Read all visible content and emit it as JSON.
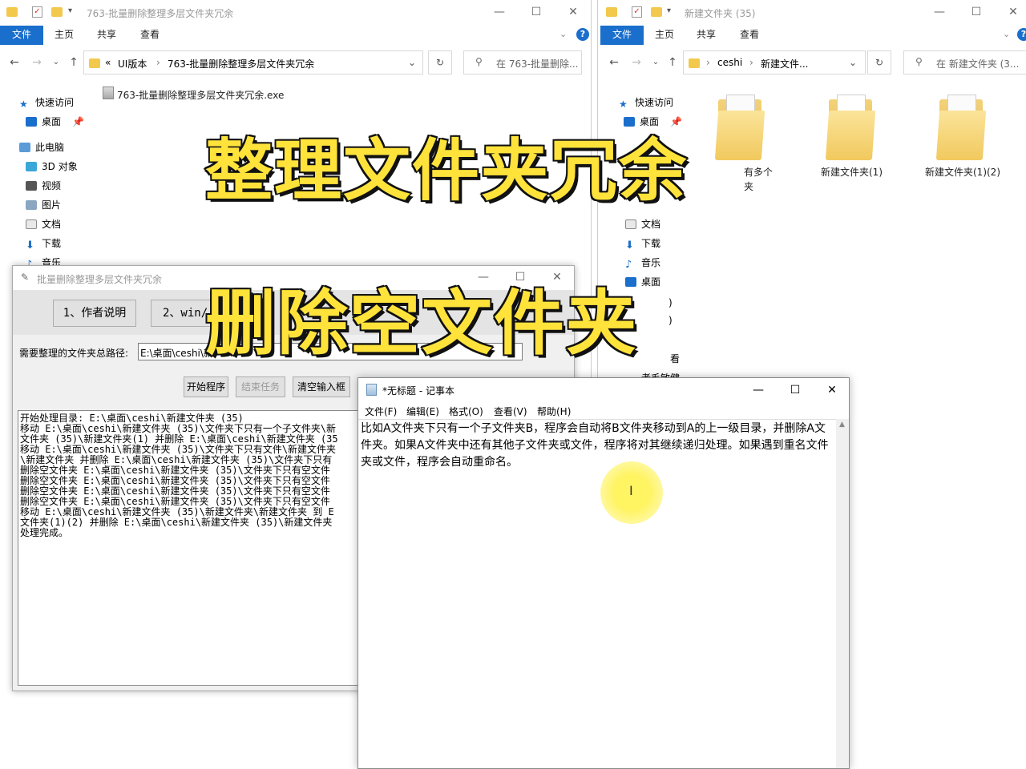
{
  "explorer_left": {
    "title": "763-批量删除整理多层文件夹冗余",
    "ribbon_tabs": [
      "文件",
      "主页",
      "共享",
      "查看"
    ],
    "address": [
      "«",
      "UI版本",
      "›",
      "763-批量删除整理多层文件夹冗余"
    ],
    "search_placeholder": "在 763-批量删除...",
    "file_name": "763-批量删除整理多层文件夹冗余.exe",
    "nav": [
      "快速访问",
      "桌面",
      "此电脑",
      "3D 对象",
      "视频",
      "图片",
      "文档",
      "下载",
      "音乐"
    ]
  },
  "explorer_right": {
    "title": "新建文件夹 (35)",
    "ribbon_tabs": [
      "文件",
      "主页",
      "共享",
      "查看"
    ],
    "address": [
      "›",
      "ceshi",
      "›",
      "新建文件..."
    ],
    "search_placeholder": "在 新建文件夹 (3...",
    "nav": [
      "快速访问",
      "桌面",
      "文档",
      "下载",
      "音乐",
      "桌面"
    ],
    "folders": [
      "有多个",
      "新建文件夹(1)",
      "新建文件夹(1)(2)"
    ],
    "folder_subtext": "夹",
    "partial_texts": [
      ")",
      ")",
      "看",
      "者毛敏健"
    ]
  },
  "tool_window": {
    "title": "批量删除整理多层文件夹冗余",
    "tab_buttons": [
      "1、作者说明",
      "2、win/"
    ],
    "path_label": "需要整理的文件夹总路径:",
    "path_value": "E:\\桌面\\ceshi\\新",
    "buttons": [
      "开始程序",
      "结束任务",
      "清空输入框"
    ],
    "log_lines": [
      "开始处理目录: E:\\桌面\\ceshi\\新建文件夹 (35)",
      "移动 E:\\桌面\\ceshi\\新建文件夹 (35)\\文件夹下只有一个子文件夹\\新",
      "文件夹 (35)\\新建文件夹(1) 并删除 E:\\桌面\\ceshi\\新建文件夹 (35",
      "移动 E:\\桌面\\ceshi\\新建文件夹 (35)\\文件夹下只有文件\\新建文件夹",
      "\\新建文件夹 并删除 E:\\桌面\\ceshi\\新建文件夹 (35)\\文件夹下只有",
      "删除空文件夹 E:\\桌面\\ceshi\\新建文件夹 (35)\\文件夹下只有空文件",
      "删除空文件夹 E:\\桌面\\ceshi\\新建文件夹 (35)\\文件夹下只有空文件",
      "删除空文件夹 E:\\桌面\\ceshi\\新建文件夹 (35)\\文件夹下只有空文件",
      "删除空文件夹 E:\\桌面\\ceshi\\新建文件夹 (35)\\文件夹下只有空文件",
      "移动 E:\\桌面\\ceshi\\新建文件夹 (35)\\新建文件夹\\新建文件夹 到 E",
      "文件夹(1)(2) 并删除 E:\\桌面\\ceshi\\新建文件夹 (35)\\新建文件夹",
      "处理完成。"
    ]
  },
  "notepad": {
    "title": "*无标题 - 记事本",
    "menu": [
      "文件(F)",
      "编辑(E)",
      "格式(O)",
      "查看(V)",
      "帮助(H)"
    ],
    "text": "比如A文件夹下只有一个子文件夹B，程序会自动将B文件夹移动到A的上一级目录，并删除A文件夹。如果A文件夹中还有其他子文件夹或文件，程序将对其继续递归处理。如果遇到重名文件夹或文件，程序会自动重命名。"
  },
  "overlay": {
    "line1": "整理文件夹冗余",
    "line2": "删除空文件夹"
  },
  "colors": {
    "accent": "#1a6ecc",
    "overlay_fill": "#ffe33b",
    "cursor_highlight": "#fff35a"
  }
}
